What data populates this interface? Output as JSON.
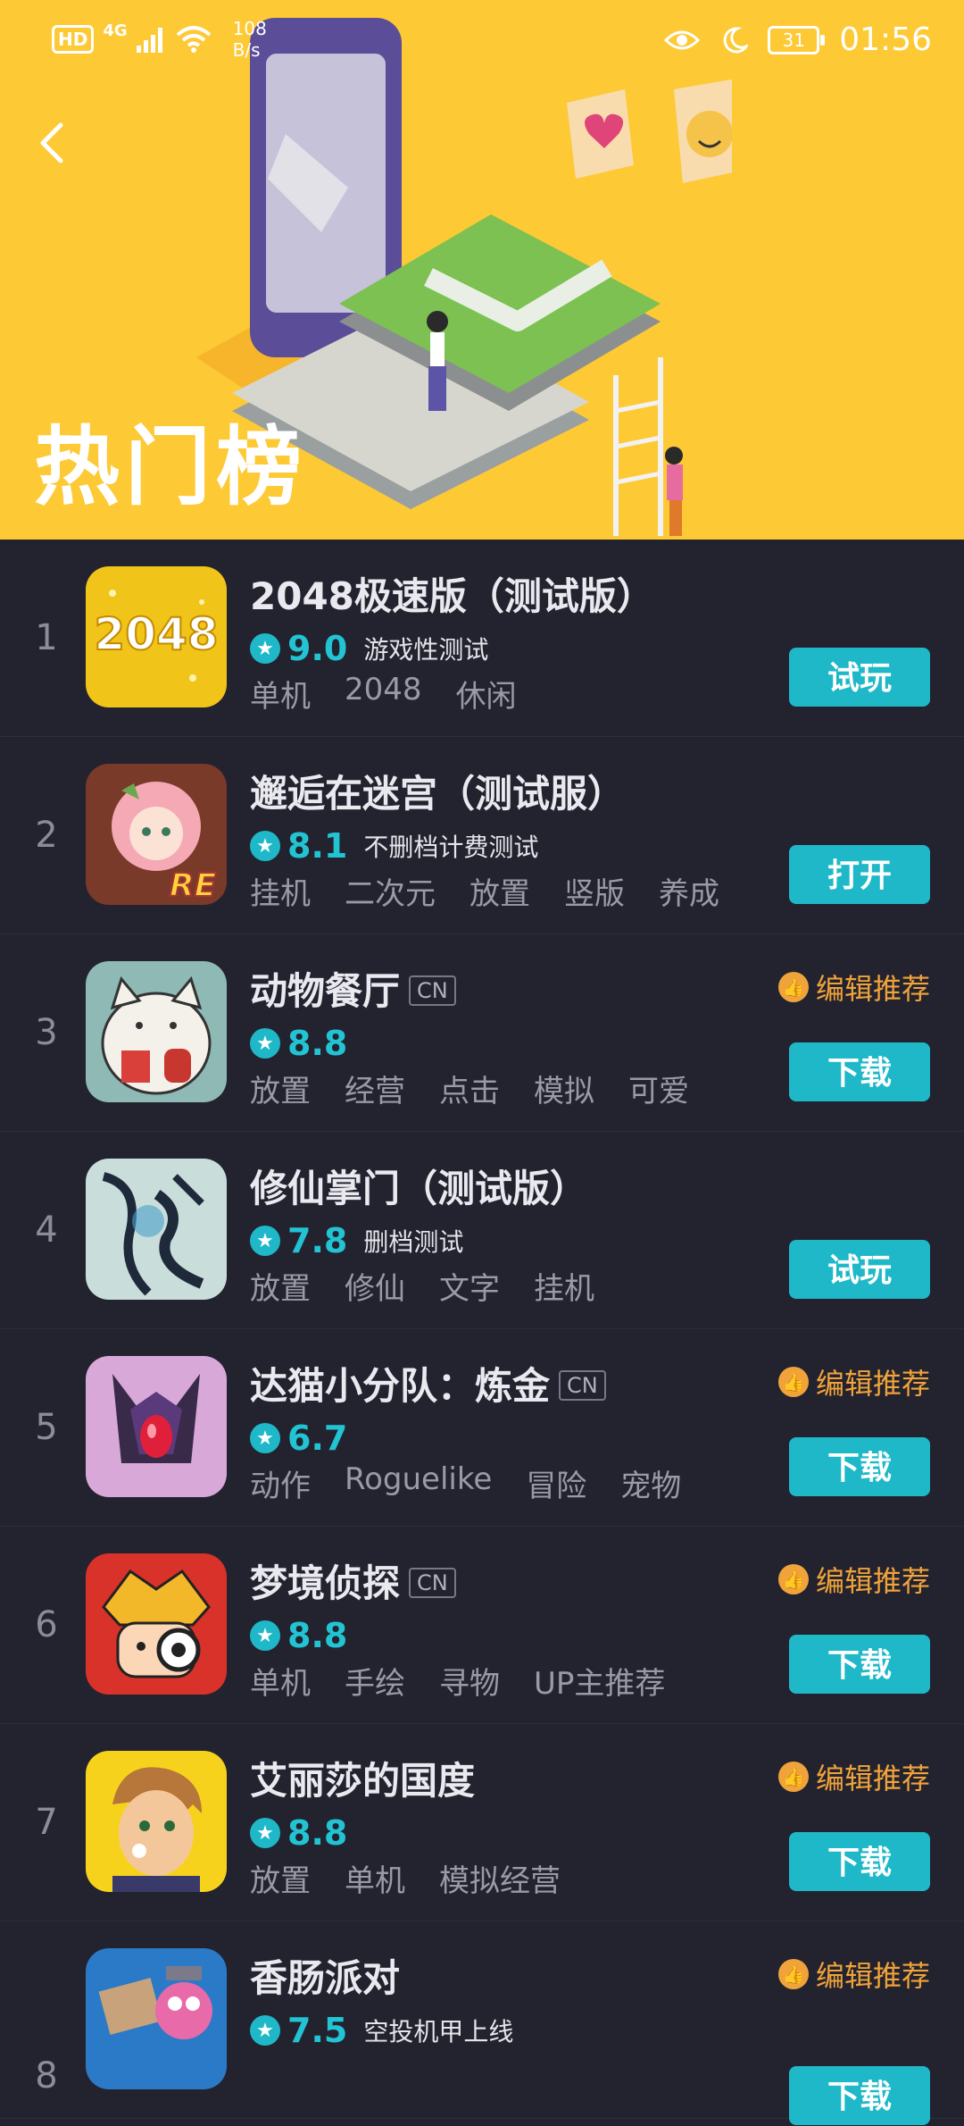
{
  "status_bar": {
    "hd": "HD",
    "network": "4G",
    "speed_value": "108",
    "speed_unit": "B/s",
    "battery": "31",
    "time": "01:56"
  },
  "header": {
    "title": "热门榜"
  },
  "colors": {
    "header_bg": "#fdc935",
    "page_bg": "#23232f",
    "accent": "#1fb8c8",
    "editor_pick": "#f0a33a"
  },
  "apps": [
    {
      "rank": "1",
      "name": "2048极速版（测试版）",
      "score": "9.0",
      "note": "游戏性测试",
      "tags": [
        "单机",
        "2048",
        "休闲"
      ],
      "action": "试玩",
      "icon": "2048-game-icon",
      "icon_text": "2048"
    },
    {
      "rank": "2",
      "name": "邂逅在迷宫（测试服）",
      "score": "8.1",
      "note": "不删档计费测试",
      "tags": [
        "挂机",
        "二次元",
        "放置",
        "竖版",
        "养成"
      ],
      "action": "打开",
      "icon": "anime-girl-icon",
      "icon_text": "RE"
    },
    {
      "rank": "3",
      "name": "动物餐厅",
      "cn": "CN",
      "editor_pick": "编辑推荐",
      "score": "8.8",
      "note": "",
      "tags": [
        "放置",
        "经营",
        "点击",
        "模拟",
        "可爱"
      ],
      "action": "下载",
      "icon": "cat-icon"
    },
    {
      "rank": "4",
      "name": "修仙掌门（测试版）",
      "score": "7.8",
      "note": "删档测试",
      "tags": [
        "放置",
        "修仙",
        "文字",
        "挂机"
      ],
      "action": "试玩",
      "icon": "calligraphy-icon"
    },
    {
      "rank": "5",
      "name": "达猫小分队：炼金",
      "cn": "CN",
      "editor_pick": "编辑推荐",
      "score": "6.7",
      "note": "",
      "tags": [
        "动作",
        "Roguelike",
        "冒险",
        "宠物"
      ],
      "action": "下载",
      "icon": "robot-cat-icon"
    },
    {
      "rank": "6",
      "name": "梦境侦探",
      "cn": "CN",
      "editor_pick": "编辑推荐",
      "score": "8.8",
      "note": "",
      "tags": [
        "单机",
        "手绘",
        "寻物",
        "UP主推荐"
      ],
      "action": "下载",
      "icon": "detective-icon"
    },
    {
      "rank": "7",
      "name": "艾丽莎的国度",
      "editor_pick": "编辑推荐",
      "score": "8.8",
      "note": "",
      "tags": [
        "放置",
        "单机",
        "模拟经营"
      ],
      "action": "下载",
      "icon": "boy-face-icon"
    },
    {
      "rank": "8",
      "name": "香肠派对",
      "editor_pick": "编辑推荐",
      "score": "7.5",
      "note": "空投机甲上线",
      "tags": [],
      "action": "下载",
      "icon": "mech-icon"
    }
  ]
}
